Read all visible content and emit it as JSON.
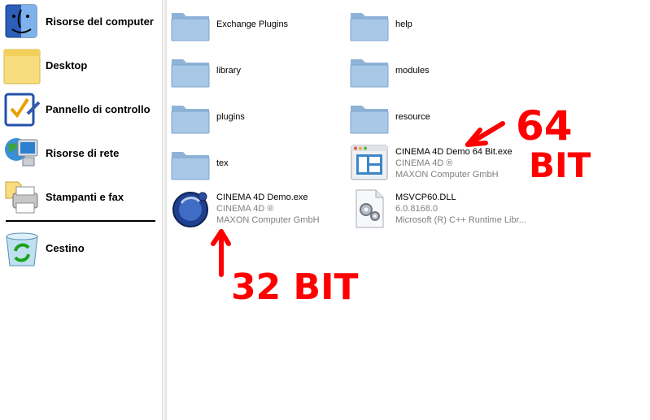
{
  "sidebar": {
    "items": [
      {
        "label": "Risorse del computer",
        "icon": "my-computer-icon"
      },
      {
        "label": "Desktop",
        "icon": "desktop-icon"
      },
      {
        "label": "Pannello di controllo",
        "icon": "control-panel-icon"
      },
      {
        "label": "Risorse di rete",
        "icon": "network-icon"
      },
      {
        "label": "Stampanti e fax",
        "icon": "printer-icon"
      },
      {
        "label": "Cestino",
        "icon": "recycle-bin-icon"
      }
    ]
  },
  "files": [
    {
      "name": "Exchange Plugins",
      "type": "folder"
    },
    {
      "name": "help",
      "type": "folder"
    },
    {
      "name": "library",
      "type": "folder"
    },
    {
      "name": "modules",
      "type": "folder"
    },
    {
      "name": "plugins",
      "type": "folder"
    },
    {
      "name": "resource",
      "type": "folder"
    },
    {
      "name": "tex",
      "type": "folder"
    },
    {
      "name": "CINEMA 4D Demo 64 Bit.exe",
      "line2": "CINEMA 4D ®",
      "line3": "MAXON Computer GmbH",
      "type": "application-window-icon"
    },
    {
      "name": "CINEMA 4D Demo.exe",
      "line2": "CINEMA 4D ®",
      "line3": "MAXON Computer GmbH",
      "type": "cinema4d-icon"
    },
    {
      "name": "MSVCP60.DLL",
      "line2": "6.0.8168.0",
      "line3": "Microsoft (R) C++ Runtime Libr...",
      "type": "dll-gears-icon"
    }
  ],
  "annotations": {
    "bits64_number": "64",
    "bits64_word": "BIT",
    "bits32": "32 BIT",
    "color": "#ff0000"
  }
}
